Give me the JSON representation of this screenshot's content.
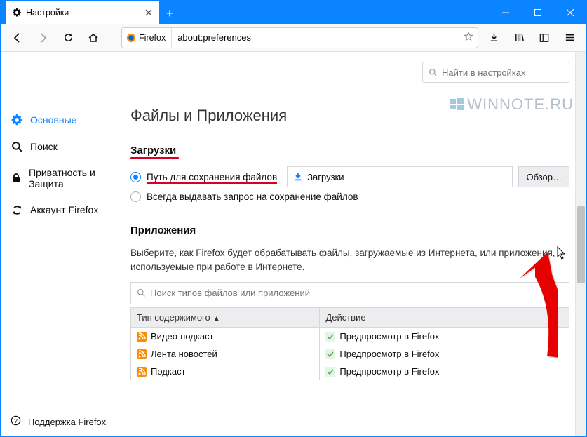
{
  "titlebar": {
    "tab_title": "Настройки"
  },
  "urlbar": {
    "identity": "Firefox",
    "url": "about:preferences"
  },
  "search": {
    "placeholder": "Найти в настройках"
  },
  "sidebar": {
    "items": [
      {
        "label": "Основные"
      },
      {
        "label": "Поиск"
      },
      {
        "label": "Приватность и Защита"
      },
      {
        "label": "Аккаунт Firefox"
      }
    ],
    "support": "Поддержка Firefox"
  },
  "main": {
    "heading": "Файлы и Приложения",
    "downloads": {
      "title": "Загрузки",
      "save_to_label": "Путь для сохранения файлов",
      "folder_name": "Загрузки",
      "browse": "Обзор…",
      "always_ask": "Всегда выдавать запрос на сохранение файлов"
    },
    "apps": {
      "title": "Приложения",
      "desc": "Выберите, как Firefox будет обрабатывать файлы, загружаемые из Интернета, или приложения, используемые при работе в Интернете.",
      "search_placeholder": "Поиск типов файлов или приложений",
      "col_type": "Тип содержимого",
      "col_action": "Действие",
      "rows": [
        {
          "type": "Видео-подкаст",
          "action": "Предпросмотр в Firefox"
        },
        {
          "type": "Лента новостей",
          "action": "Предпросмотр в Firefox"
        },
        {
          "type": "Подкаст",
          "action": "Предпросмотр в Firefox"
        }
      ]
    }
  },
  "watermark": "WINNOTE.RU"
}
